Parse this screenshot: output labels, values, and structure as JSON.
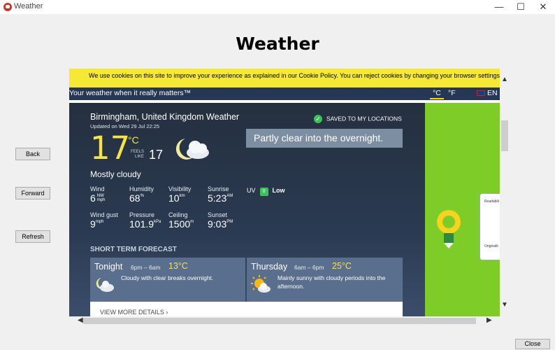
{
  "window": {
    "title": "Weather",
    "min": "—",
    "max": "☐",
    "close": "✕"
  },
  "page_heading": "Weather",
  "nav_buttons": {
    "back": "Back",
    "forward": "Forward",
    "refresh": "Refresh"
  },
  "footer": {
    "close": "Close"
  },
  "cookie_banner": "We use cookies on this site to improve your experience as explained in our Cookie Policy. You can reject cookies by changing your browser settings.",
  "site_nav": {
    "tagline": "Your weather when it really matters™",
    "unit_c": "°C",
    "unit_f": "°F",
    "language": "EN"
  },
  "location": {
    "title": "Birmingham, United Kingdom Weather",
    "updated": "Updated on Wed 29 Jul 22:25",
    "saved": "SAVED TO MY LOCATIONS"
  },
  "current": {
    "temp": "17",
    "temp_unit": "°C",
    "feels_label_1": "FEELS",
    "feels_label_2": "LIKE",
    "feels_like": "17",
    "condition": "Mostly cloudy",
    "summary": "Partly clear into the overnight."
  },
  "stats": {
    "wind": {
      "label": "Wind",
      "value": "6",
      "unit_top": "NW",
      "unit_bottom": "mph"
    },
    "humidity": {
      "label": "Humidity",
      "value": "68",
      "unit": "%"
    },
    "visibility": {
      "label": "Visibility",
      "value": "10",
      "unit": "km"
    },
    "sunrise": {
      "label": "Sunrise",
      "value": "5:23",
      "unit": "AM"
    },
    "wind_gust": {
      "label": "Wind gust",
      "value": "9",
      "unit": "mph"
    },
    "pressure": {
      "label": "Pressure",
      "value": "101.9",
      "unit": "kPa"
    },
    "ceiling": {
      "label": "Ceiling",
      "value": "1500",
      "unit": "m"
    },
    "sunset": {
      "label": "Sunset",
      "value": "9:03",
      "unit": "PM"
    },
    "uv": {
      "label": "UV",
      "index": "0",
      "level": "Low"
    }
  },
  "short_term": {
    "heading": "SHORT TERM FORECAST",
    "cards": [
      {
        "day": "Tonight",
        "time": "6pm – 6am",
        "temp": "13°C",
        "desc": "Cloudy with clear breaks overnight."
      },
      {
        "day": "Thursday",
        "time": "6am – 6pm",
        "temp": "25°C",
        "desc_1": "Mainly sunny with cloudy periods into the",
        "desc_2": "afternoon."
      }
    ],
    "more": "VIEW MORE DETAILS ›"
  },
  "ad": {
    "label_1": "Readabili",
    "label_2": "Originalit"
  },
  "colors": {
    "accent_yellow": "#f7e24a",
    "cookie_bg": "#f5e935",
    "nav_bg": "#253754",
    "ad_green": "#7ecc28",
    "check_green": "#3ec05a"
  }
}
